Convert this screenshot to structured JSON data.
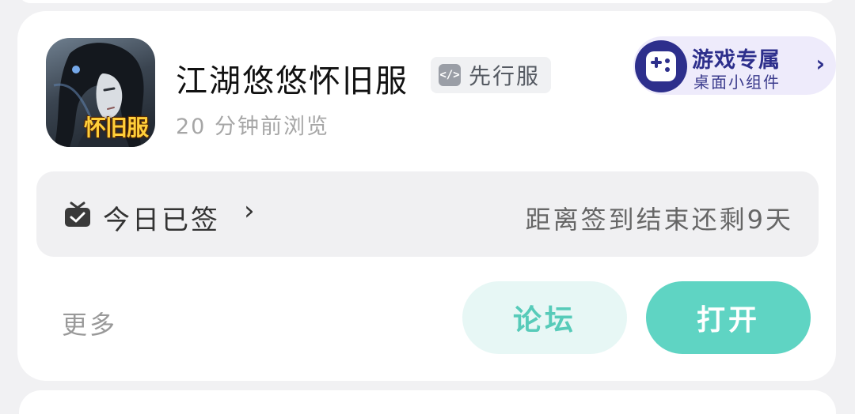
{
  "app": {
    "name": "江湖悠悠怀旧服",
    "tag_label": "先行服",
    "tag_icon": "code-icon",
    "last_viewed": "20 分钟前浏览",
    "icon_badge_text": "怀旧服"
  },
  "widget": {
    "title": "游戏专属",
    "subtitle": "桌面小组件",
    "chevron": "›",
    "icon": "gamepad-icon"
  },
  "signin": {
    "icon": "gift-check-icon",
    "status_label": "今日已签",
    "chevron": "›",
    "countdown_text": "距离签到结束还剩9天"
  },
  "actions": {
    "more_label": "更多",
    "forum_label": "论坛",
    "open_label": "打开"
  },
  "colors": {
    "accent": "#5fd4c3",
    "accent_light": "#e7f7f5",
    "widget_bg": "#eeebfb",
    "widget_fg": "#2d2f8c"
  }
}
